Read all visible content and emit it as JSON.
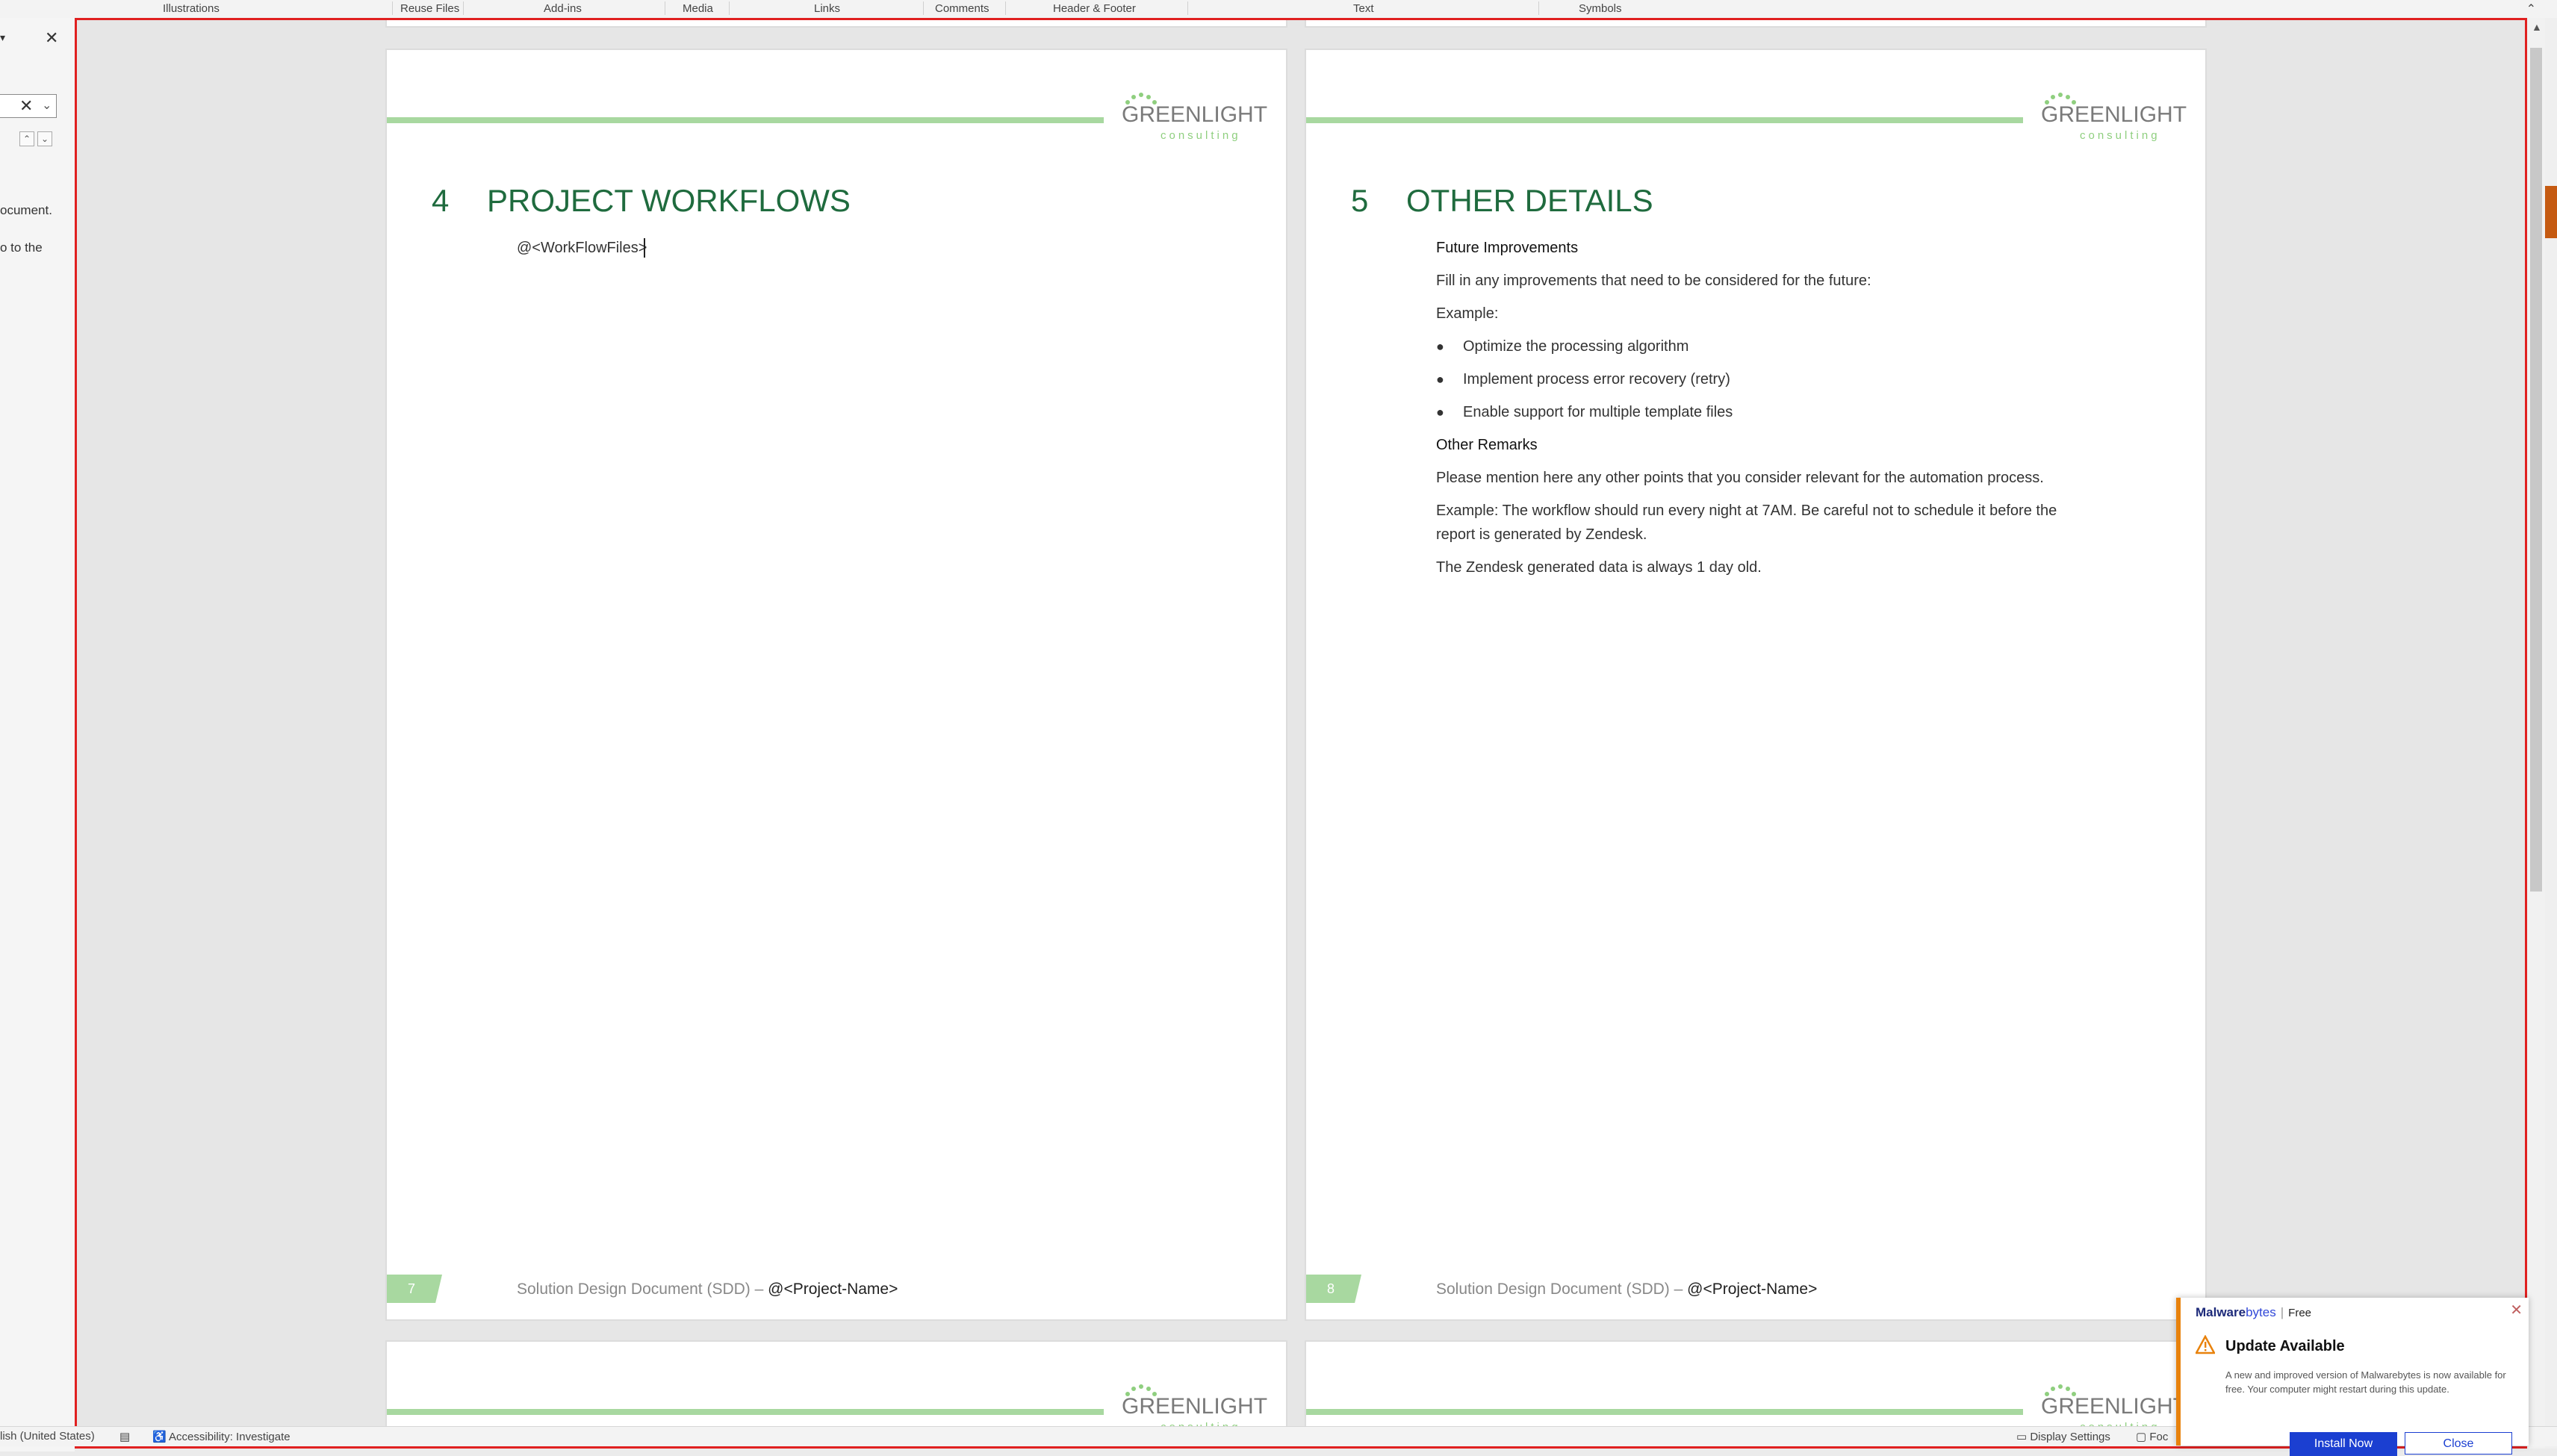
{
  "ribbon": {
    "groups": [
      "Illustrations",
      "Reuse Files",
      "Add-ins",
      "Media",
      "Links",
      "Comments",
      "Header & Footer",
      "Text",
      "Symbols"
    ]
  },
  "nav_pane": {
    "search_clear": "✕",
    "close": "✕",
    "text_fragment_1": "ocument.",
    "text_fragment_2": "o to the"
  },
  "pages": [
    {
      "logo": "GREENLIGHT",
      "logo_sub": "consulting",
      "heading_number": "4",
      "heading_title": "PROJECT WORKFLOWS",
      "placeholder": "@<WorkFlowFiles>",
      "footer_page": "7",
      "footer_doc": "Solution Design Document (SDD) –",
      "footer_project": "@<Project-Name>"
    },
    {
      "logo": "GREENLIGHT",
      "logo_sub": "consulting",
      "heading_number": "5",
      "heading_title": "OTHER DETAILS",
      "future_heading": "Future Improvements",
      "future_intro": "Fill in any improvements that need to be considered for the future:",
      "example_label": "Example:",
      "bullets": [
        "Optimize the processing algorithm",
        "Implement process error recovery (retry)",
        "Enable support for multiple template files"
      ],
      "remarks_heading": "Other Remarks",
      "remarks_intro": "Please mention here any other points that you consider relevant for the automation process.",
      "remarks_example_line1": "Example: The workflow should run every night at 7AM. Be careful not to schedule it before the",
      "remarks_example_line2": "report is generated by Zendesk.",
      "remarks_note": "The Zendesk generated data is always 1 day old.",
      "footer_page": "8",
      "footer_doc": "Solution Design Document (SDD) –",
      "footer_project": "@<Project-Name>"
    }
  ],
  "status": {
    "language": "lish (United States)",
    "accessibility": "Accessibility: Investigate",
    "display_settings": "Display Settings",
    "focus": "Foc"
  },
  "toast": {
    "brand_bold": "Malware",
    "brand_light": "bytes",
    "brand_sep": "|",
    "brand_tier": "Free",
    "title": "Update Available",
    "message": "A new and improved version of Malwarebytes is now available for free. Your computer might restart during this update.",
    "install_label": "Install Now",
    "close_label": "Close"
  },
  "colors": {
    "heading_green": "#1f6b3e",
    "accent_green": "#a8d8a0",
    "toast_accent": "#e8820c",
    "toast_button": "#1b3fd1",
    "selection_border": "#e02020"
  }
}
